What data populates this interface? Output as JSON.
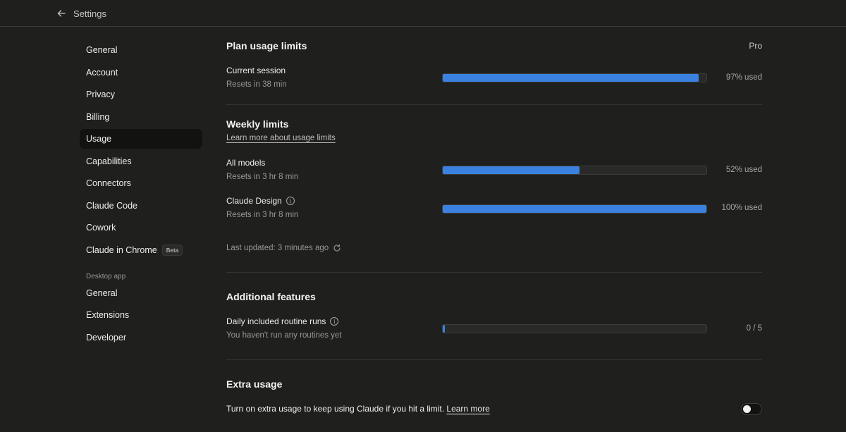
{
  "header": {
    "title": "Settings"
  },
  "sidebar": {
    "items": [
      {
        "label": "General",
        "active": false
      },
      {
        "label": "Account",
        "active": false
      },
      {
        "label": "Privacy",
        "active": false
      },
      {
        "label": "Billing",
        "active": false
      },
      {
        "label": "Usage",
        "active": true
      },
      {
        "label": "Capabilities",
        "active": false
      },
      {
        "label": "Connectors",
        "active": false
      },
      {
        "label": "Claude Code",
        "active": false
      },
      {
        "label": "Cowork",
        "active": false
      },
      {
        "label": "Claude in Chrome",
        "active": false,
        "badge": "Beta"
      }
    ],
    "desktop_section_label": "Desktop app",
    "desktop_items": [
      {
        "label": "General"
      },
      {
        "label": "Extensions"
      },
      {
        "label": "Developer"
      }
    ]
  },
  "plan": {
    "title": "Plan usage limits",
    "badge": "Pro",
    "current_session": {
      "label": "Current session",
      "sub": "Resets in 38 min",
      "value_text": "97% used",
      "fraction": 0.97
    }
  },
  "weekly": {
    "title": "Weekly limits",
    "link": "Learn more about usage limits",
    "all_models": {
      "label": "All models",
      "sub": "Resets in 3 hr 8 min",
      "value_text": "52% used",
      "fraction": 0.52
    },
    "claude_design": {
      "label": "Claude Design",
      "sub": "Resets in 3 hr 8 min",
      "value_text": "100% used",
      "fraction": 1.0
    },
    "last_updated": "Last updated: 3 minutes ago"
  },
  "additional": {
    "title": "Additional features",
    "routine_runs": {
      "label": "Daily included routine runs",
      "sub": "You haven't run any routines yet",
      "value_text": "0 / 5",
      "fraction": 0.0
    }
  },
  "extra": {
    "title": "Extra usage",
    "text": "Turn on extra usage to keep using Claude if you hit a limit. ",
    "link": "Learn more",
    "toggle_on": false
  },
  "colors": {
    "accent": "#3b82e0",
    "background": "#1f1f1e"
  }
}
